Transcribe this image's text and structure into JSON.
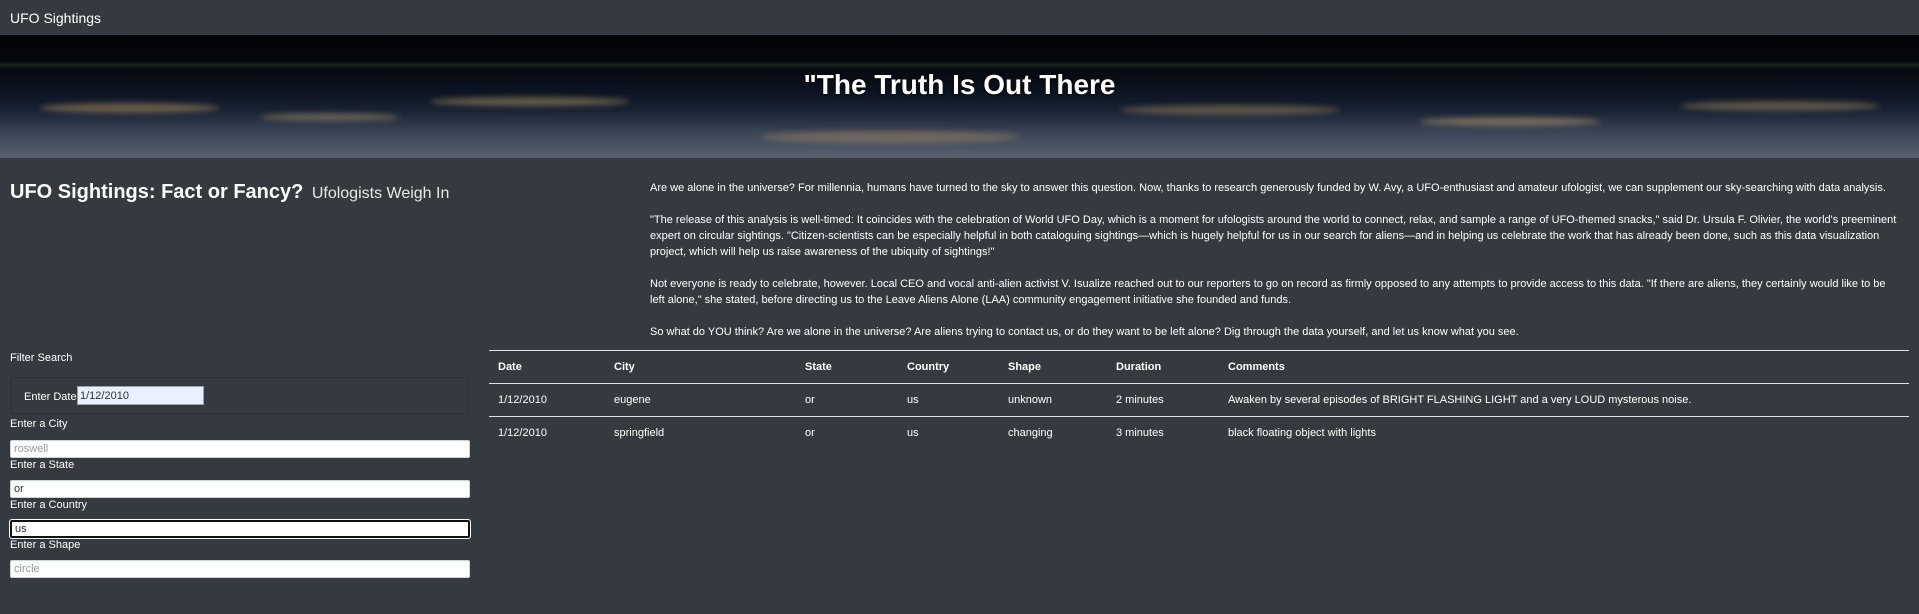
{
  "navbar": {
    "brand": "UFO Sightings"
  },
  "hero": {
    "title": "\"The Truth Is Out There"
  },
  "heading": {
    "main": "UFO Sightings: Fact or Fancy?",
    "sub": "Ufologists Weigh In"
  },
  "article": {
    "p1": "Are we alone in the universe? For millennia, humans have turned to the sky to answer this question. Now, thanks to research generously funded by W. Avy, a UFO-enthusiast and amateur ufologist, we can supplement our sky-searching with data analysis.",
    "p2": "\"The release of this analysis is well-timed: It coincides with the celebration of World UFO Day, which is a moment for ufologists around the world to connect, relax, and sample a range of UFO-themed snacks,\" said Dr. Ursula F. Olivier, the world's preeminent expert on circular sightings. \"Citizen-scientists can be especially helpful in both cataloguing sightings—which is hugely helpful for us in our search for aliens—and in helping us celebrate the work that has already been done, such as this data visualization project, which will help us raise awareness of the ubiquity of sightings!\"",
    "p3": "Not everyone is ready to celebrate, however. Local CEO and vocal anti-alien activist V. Isualize reached out to our reporters to go on record as firmly opposed to any attempts to provide access to this data. \"If there are aliens, they certainly would like to be left alone,\" she stated, before directing us to the Leave Aliens Alone (LAA) community engagement initiative she founded and funds.",
    "p4": "So what do YOU think? Are we alone in the universe? Are aliens trying to contact us, or do they want to be left alone? Dig through the data yourself, and let us know what you see."
  },
  "filters": {
    "title": "Filter Search",
    "date": {
      "label": "Enter Date",
      "value": "1/12/2010"
    },
    "city": {
      "label": "Enter a City",
      "placeholder": "roswell"
    },
    "state": {
      "label": "Enter a State",
      "value": "or"
    },
    "country": {
      "label": "Enter a Country",
      "value": "us"
    },
    "shape": {
      "label": "Enter a Shape",
      "placeholder": "circle"
    }
  },
  "table": {
    "headers": [
      "Date",
      "City",
      "State",
      "Country",
      "Shape",
      "Duration",
      "Comments"
    ],
    "rows": [
      [
        "1/12/2010",
        "eugene",
        "or",
        "us",
        "unknown",
        "2 minutes",
        "Awaken by several episodes of BRIGHT FLASHING LIGHT and a very LOUD mysterous noise."
      ],
      [
        "1/12/2010",
        "springfield",
        "or",
        "us",
        "changing",
        "3 minutes",
        "black floating object with lights"
      ]
    ]
  }
}
